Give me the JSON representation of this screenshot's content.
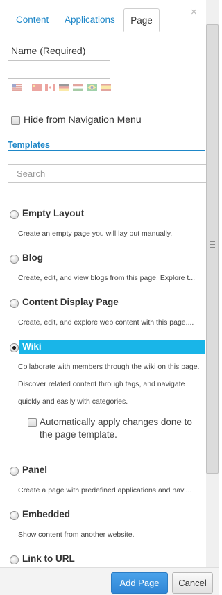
{
  "tabs": [
    {
      "label": "Content",
      "active": false
    },
    {
      "label": "Applications",
      "active": false
    },
    {
      "label": "Page",
      "active": true
    }
  ],
  "close_symbol": "×",
  "name": {
    "label": "Name (Required)",
    "value": "",
    "flags": [
      "us-flag-icon",
      "cn-flag-icon",
      "ca-flag-icon",
      "de-flag-icon",
      "hu-flag-icon",
      "br-flag-icon",
      "es-flag-icon"
    ]
  },
  "hide_nav": {
    "label": "Hide from Navigation Menu",
    "checked": false
  },
  "templates": {
    "heading": "Templates",
    "search_placeholder": "Search",
    "options": [
      {
        "title": "Empty Layout",
        "desc": [
          "Create an empty page you will lay out manually."
        ],
        "selected": false
      },
      {
        "title": "Blog",
        "desc": [
          "Create, edit, and view blogs from this page. Explore t..."
        ],
        "selected": false
      },
      {
        "title": "Content Display Page",
        "desc": [
          "Create, edit, and explore web content with this page...."
        ],
        "selected": false
      },
      {
        "title": "Wiki",
        "desc": [
          "Collaborate with members through the wiki on this page.",
          "Discover related content through tags, and navigate",
          "quickly and easily with categories."
        ],
        "selected": true
      },
      {
        "title": "Panel",
        "desc": [
          "Create a page with predefined applications and navi..."
        ],
        "selected": false
      },
      {
        "title": "Embedded",
        "desc": [
          "Show content from another website."
        ],
        "selected": false
      },
      {
        "title": "Link to URL",
        "desc": [],
        "selected": false
      }
    ],
    "auto_apply": {
      "label": "Automatically apply changes done to the page template.",
      "checked": false
    }
  },
  "buttons": {
    "add": "Add Page",
    "cancel": "Cancel"
  },
  "colors": {
    "accent": "#1e87c8",
    "selected_bar": "#19b5e8",
    "primary_button": "#3a92de"
  }
}
